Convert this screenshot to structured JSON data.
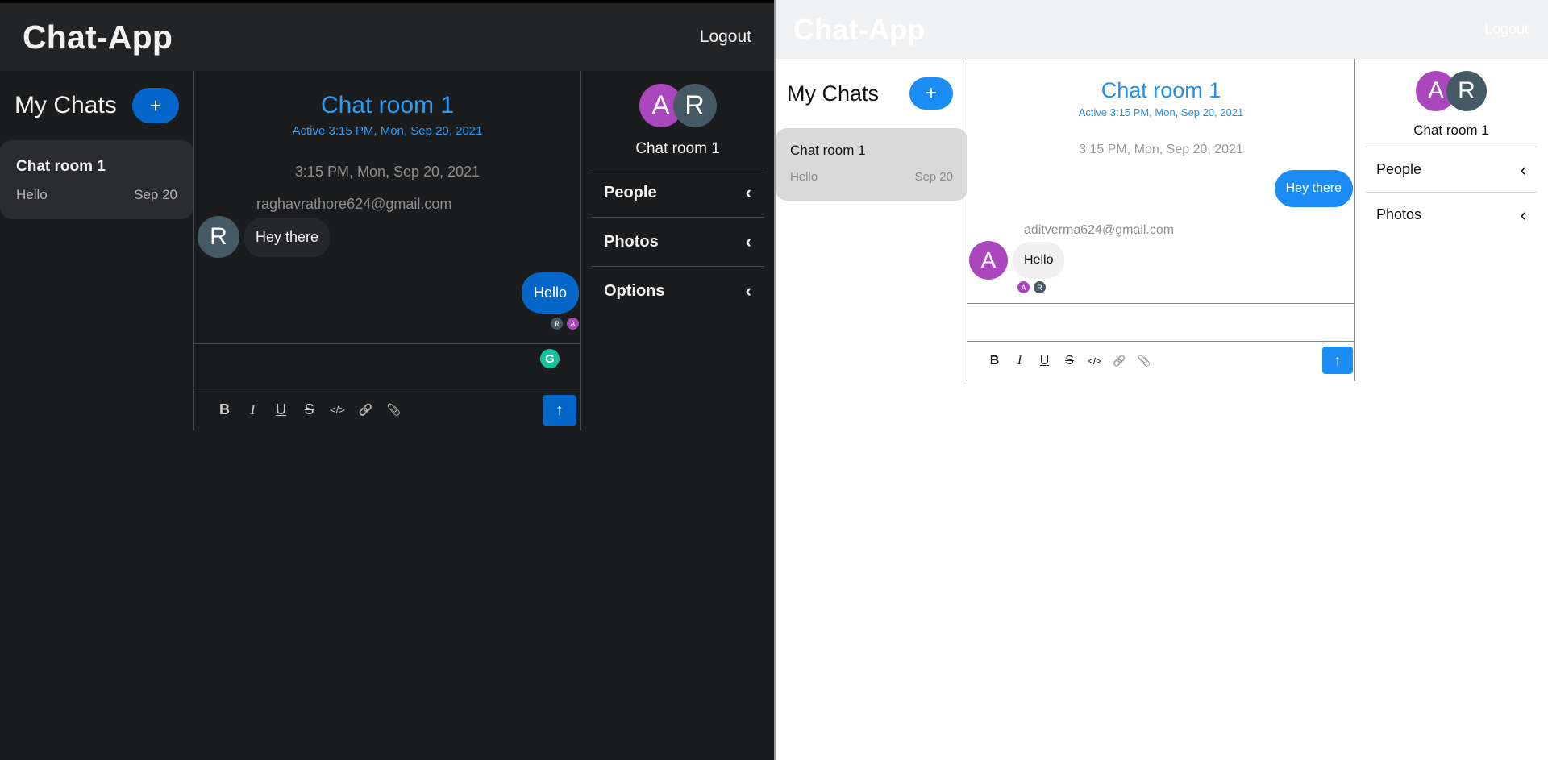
{
  "app": {
    "brand": "Chat-App",
    "logout_label": "Logout"
  },
  "dark": {
    "sidebar": {
      "title": "My Chats",
      "add_label": "+"
    },
    "chat_card": {
      "name": "Chat room 1",
      "last_message": "Hello",
      "date": "Sep 20"
    },
    "room": {
      "title": "Chat room 1",
      "active": "Active 3:15 PM, Mon, Sep 20, 2021"
    },
    "thread": {
      "timestamp": "3:15 PM, Mon, Sep 20, 2021",
      "incoming": {
        "email": "raghavrathore624@gmail.com",
        "avatar_letter": "R",
        "text": "Hey there"
      },
      "outgoing": {
        "text": "Hello"
      },
      "read_receipts": [
        "R",
        "A"
      ]
    },
    "composer": {
      "grammarly_letter": "G"
    },
    "details": {
      "avatars": [
        "A",
        "R"
      ],
      "name": "Chat room 1",
      "sections": [
        "People",
        "Photos",
        "Options"
      ]
    }
  },
  "light": {
    "sidebar": {
      "title": "My Chats",
      "add_label": "+"
    },
    "chat_card": {
      "name": "Chat room 1",
      "last_message": "Hello",
      "date": "Sep 20"
    },
    "room": {
      "title": "Chat room 1",
      "active": "Active 3:15 PM, Mon, Sep 20, 2021"
    },
    "thread": {
      "timestamp": "3:15 PM, Mon, Sep 20, 2021",
      "outgoing": {
        "text": "Hey there"
      },
      "incoming": {
        "email": "aditverma624@gmail.com",
        "avatar_letter": "A",
        "text": "Hello"
      },
      "read_receipts": [
        "A",
        "R"
      ]
    },
    "details": {
      "avatars": [
        "A",
        "R"
      ],
      "name": "Chat room 1",
      "sections": [
        "People",
        "Photos"
      ]
    }
  },
  "toolbar": {
    "icons": [
      "bold-icon",
      "italic-icon",
      "underline-icon",
      "strikethrough-icon",
      "code-icon",
      "link-icon",
      "attach-icon"
    ],
    "bold": "B",
    "italic": "I",
    "underline": "U",
    "strike": "S",
    "code": "</>",
    "link": "🔗",
    "attach": "📎",
    "send": "↑"
  },
  "colors": {
    "accent_dark": "#0466c8",
    "accent_light": "#1c8cf5",
    "title_blue": "#2c9cf5",
    "avatar_a": "#ab47bc",
    "avatar_r": "#455a64",
    "grammarly": "#15c39a"
  }
}
